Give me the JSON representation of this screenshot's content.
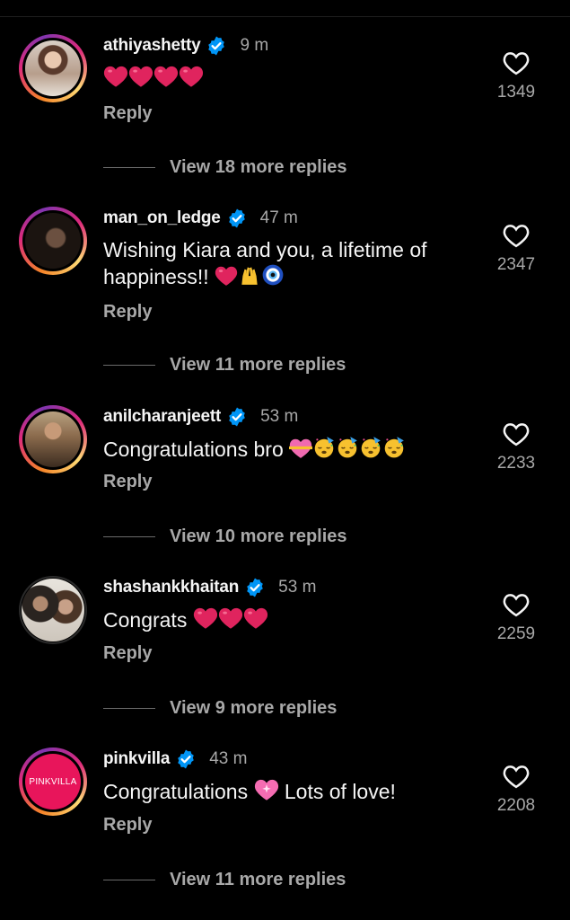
{
  "comments": [
    {
      "username": "athiyashetty",
      "time": "9 m",
      "text": "",
      "emojis": "❤️❤️❤️❤️",
      "reply_label": "Reply",
      "likes": "1349",
      "view_replies": "View 18 more replies"
    },
    {
      "username": "man_on_ledge",
      "time": "47 m",
      "text_line1": "Wishing Kiara and you, a lifetime of",
      "text_line2": "happiness!!",
      "reply_label": "Reply",
      "likes": "2347",
      "view_replies": "View 11 more replies"
    },
    {
      "username": "anilcharanjeett",
      "time": "53 m",
      "text": "Congratulations bro",
      "reply_label": "Reply",
      "likes": "2233",
      "view_replies": "View 10 more replies"
    },
    {
      "username": "shashankkhaitan",
      "time": "53 m",
      "text": "Congrats",
      "reply_label": "Reply",
      "likes": "2259",
      "view_replies": "View 9 more replies"
    },
    {
      "username": "pinkvilla",
      "time": "43 m",
      "text": "Congratulations",
      "text_after": "Lots of love!",
      "avatar_logo": "PINKVILLA",
      "reply_label": "Reply",
      "likes": "2208",
      "view_replies": "View 11 more replies"
    }
  ],
  "colors": {
    "background": "#000000",
    "primary_text": "#f5f5f5",
    "secondary_text": "#a8a8a8",
    "verified_blue": "#0095f6",
    "heart_red": "#e0245e",
    "pinkvilla_brand": "#e8155b"
  },
  "icons": [
    "verified-badge-icon",
    "heart-outline-icon"
  ]
}
